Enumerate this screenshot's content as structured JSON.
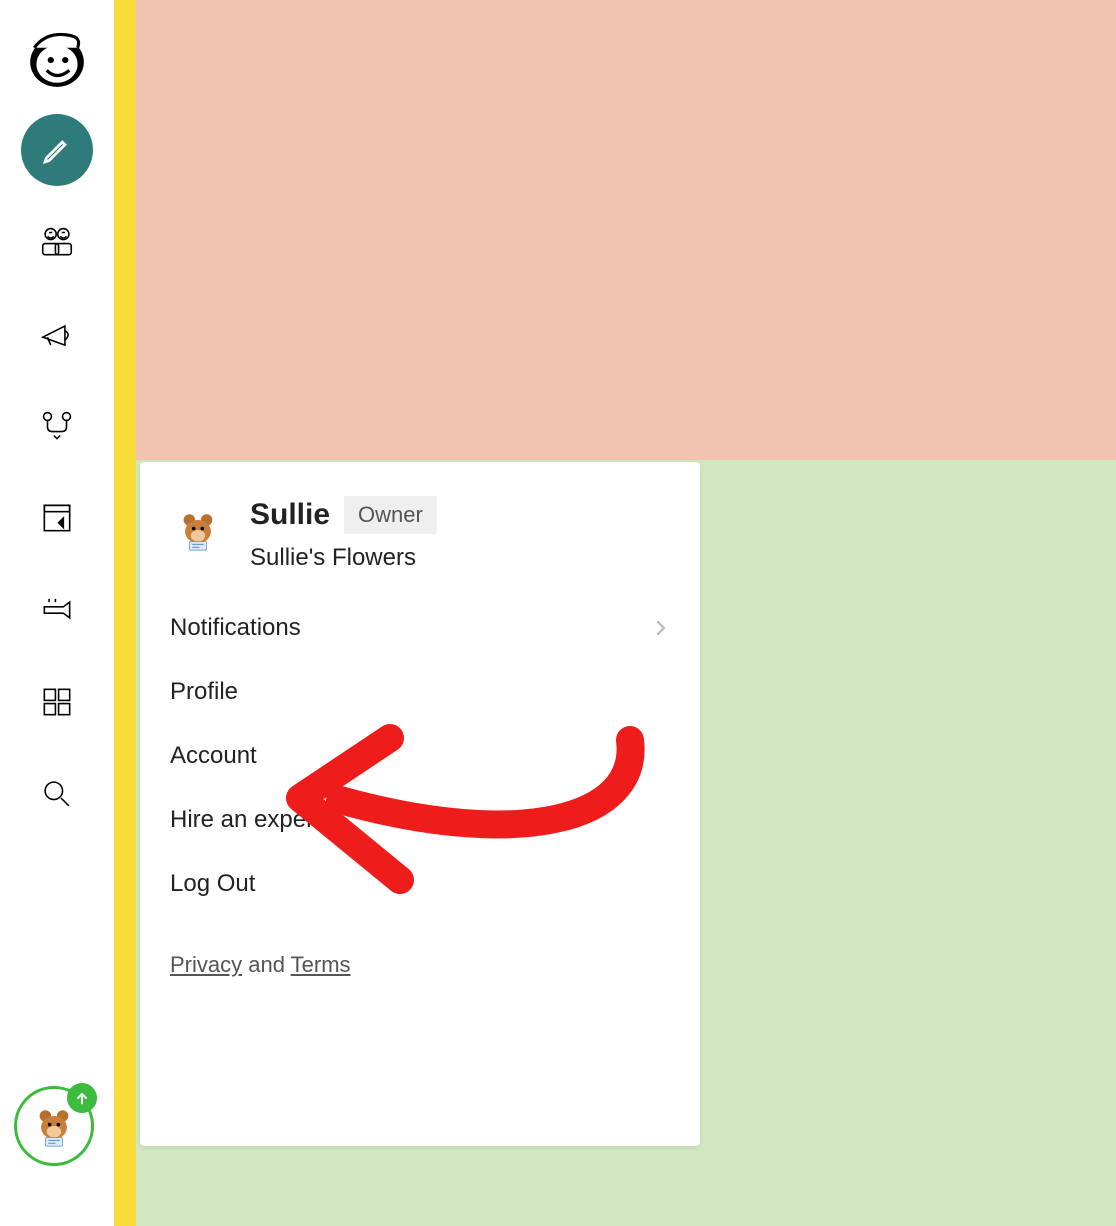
{
  "user": {
    "name": "Sullie",
    "role": "Owner",
    "org": "Sullie's Flowers"
  },
  "menu": {
    "items": [
      {
        "label": "Notifications",
        "has_chevron": true
      },
      {
        "label": "Profile",
        "has_chevron": false
      },
      {
        "label": "Account",
        "has_chevron": false
      },
      {
        "label": "Hire an expert",
        "has_chevron": false
      },
      {
        "label": "Log Out",
        "has_chevron": false
      }
    ],
    "footer": {
      "privacy": "Privacy",
      "and": " and ",
      "terms": "Terms"
    }
  },
  "sidebar_icons": [
    "create-icon",
    "audience-icon",
    "campaigns-icon",
    "automations-icon",
    "content-icon",
    "integrations-icon",
    "apps-icon",
    "search-icon"
  ]
}
